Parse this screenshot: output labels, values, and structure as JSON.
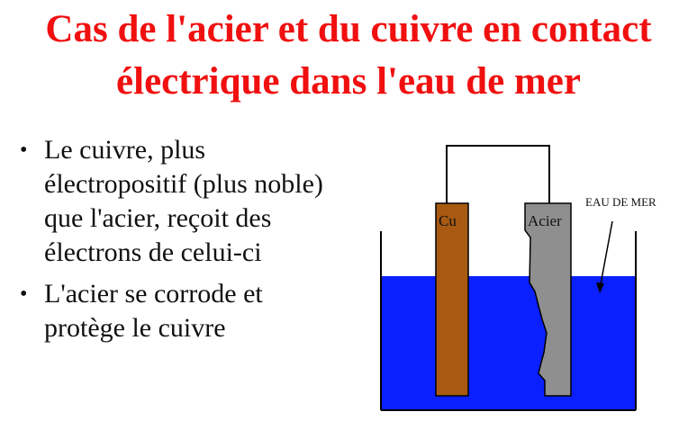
{
  "slide": {
    "title_lines": [
      "Cas de l'acier et du cuivre en contact",
      "électrique dans l'eau de mer"
    ],
    "bullets": [
      {
        "lines": [
          "Le cuivre, plus",
          "électropositif (plus  noble)",
          "que l'acier, reçoit des",
          "électrons de celui-ci"
        ]
      },
      {
        "lines": [
          "L'acier se corrode et",
          "protège le cuivre"
        ]
      }
    ],
    "bullet_symbol": "•"
  },
  "diagram": {
    "copper_label": "Cu",
    "steel_label": "Acier",
    "seawater_label": "EAU DE MER",
    "colors": {
      "title": "#f01010",
      "water": "#0a20ff",
      "copper": "#a85a12",
      "steel": "#8f8f8f",
      "outline": "#000000"
    }
  }
}
